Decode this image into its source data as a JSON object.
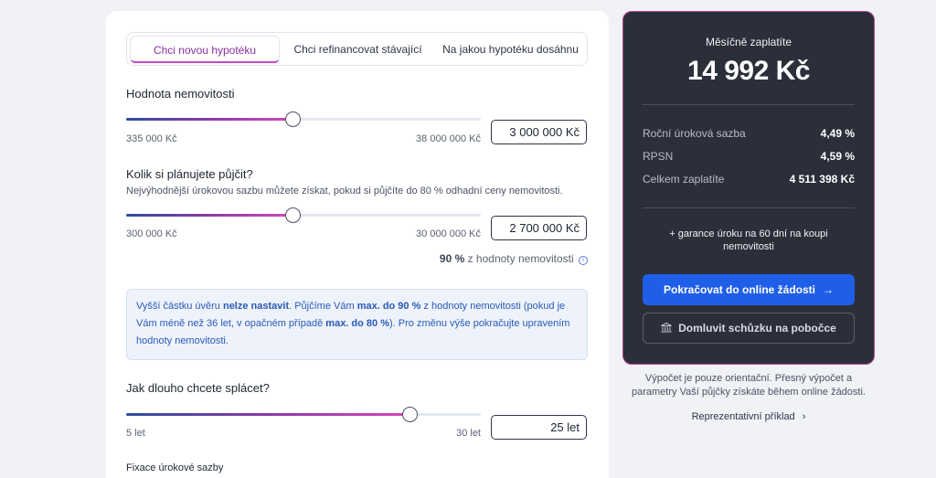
{
  "tabs": [
    {
      "label": "Chci novou hypotéku",
      "active": true
    },
    {
      "label": "Chci refinancovat stávající",
      "active": false
    },
    {
      "label": "Na jakou hypotéku dosáhnu",
      "active": false
    }
  ],
  "property": {
    "label": "Hodnota nemovitosti",
    "min": "335 000 Kč",
    "max": "38 000 000 Kč",
    "value": "3 000 000 Kč",
    "fraction": 0.47
  },
  "loan": {
    "label": "Kolik si plánujete půjčit?",
    "sublabel": "Nejvýhodnější úrokovou sazbu můžete získat, pokud si půjčíte do 80 % odhadní ceny nemovitosti.",
    "min": "300 000 Kč",
    "max": "30 000 000 Kč",
    "value": "2 700 000 Kč",
    "fraction": 0.47,
    "ratio_value": "90 %",
    "ratio_text": "z hodnoty nemovitosti"
  },
  "info": {
    "p1": "Vyšší částku úvěru ",
    "b1": "nelze nastavit",
    "p2": ". Půjčíme Vám ",
    "b2": "max. do 90 %",
    "p3": " z hodnoty nemovitosti (pokud je Vám méně než 36 let, v opačném případě ",
    "b3": "max. do 80 %",
    "p4": "). Pro změnu výše pokračujte upravením hodnoty nemovitosti."
  },
  "term": {
    "label": "Jak dlouho chcete splácet?",
    "min": "5 let",
    "max": "30 let",
    "value": "25 let",
    "fraction": 0.8
  },
  "fixation": {
    "label": "Fixace úrokové sazby"
  },
  "summary": {
    "title": "Měsíčně zaplatíte",
    "amount": "14 992 Kč",
    "rows": [
      {
        "label": "Roční úroková sazba",
        "value": "4,49 %"
      },
      {
        "label": "RPSN",
        "value": "4,59 %"
      },
      {
        "label": "Celkem zaplatíte",
        "value": "4 511 398 Kč"
      }
    ],
    "guarantee": "+ garance úroku na 60 dní na koupi nemovitosti",
    "primary_button": "Pokračovat do online žádosti",
    "secondary_button": "Domluvit schůzku na pobočce"
  },
  "note": "Výpočet je pouze orientační. Přesný výpočet a parametry Vaší půjčky získáte během online žádosti.",
  "rep_link": "Reprezentativní příklad",
  "colors": {
    "accent": "#1f5fe8",
    "panel": "#2b2f3a",
    "info": "#2a58b8",
    "tab_active": "#8a2e9e"
  }
}
